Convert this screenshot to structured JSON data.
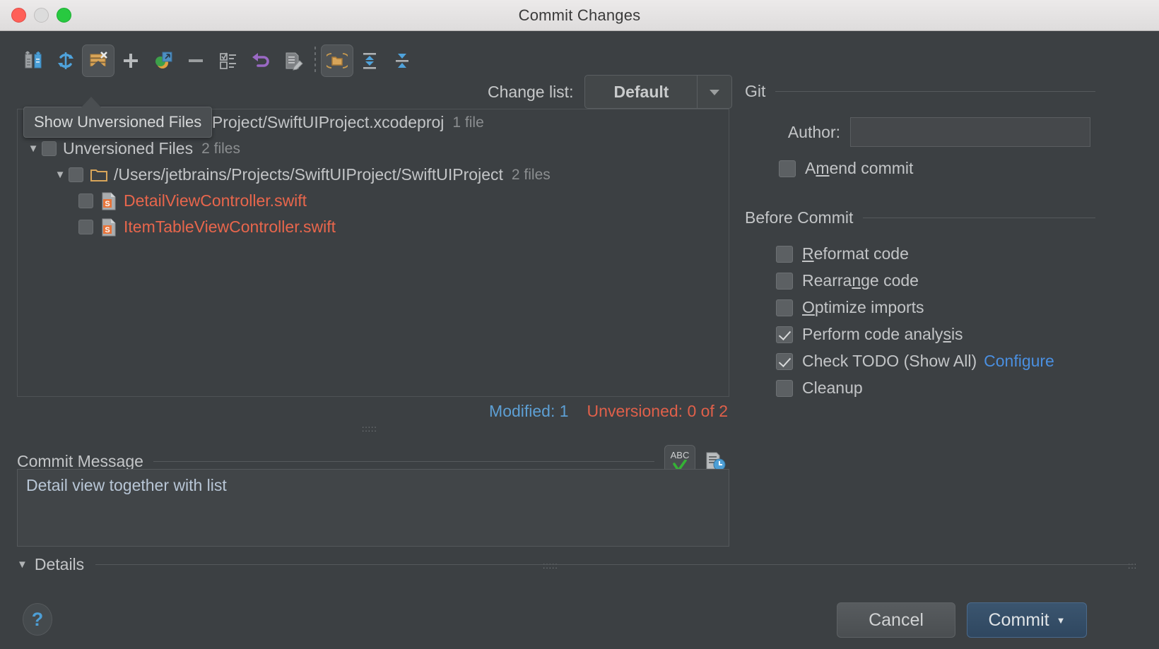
{
  "window": {
    "title": "Commit Changes",
    "traffic": [
      "close",
      "minimize",
      "maximize"
    ]
  },
  "toolbar": {
    "buttons": [
      {
        "name": "refresh-changes-icon",
        "tip": "Refresh changes"
      },
      {
        "name": "rollback-sync-icon",
        "tip": "Refresh"
      },
      {
        "name": "show-unversioned-files-icon",
        "tip": "Show Unversioned Files",
        "selected": true
      },
      {
        "name": "add-icon",
        "tip": "Add"
      },
      {
        "name": "move-to-another-changelist-icon",
        "tip": "Move to another changelist"
      },
      {
        "name": "delete-icon",
        "tip": "Delete"
      },
      {
        "name": "show-diff-list-icon",
        "tip": "Show diff list"
      },
      {
        "name": "revert-icon",
        "tip": "Revert"
      },
      {
        "name": "edit-source-icon",
        "tip": "Edit source"
      },
      {
        "name": "group-by-directory-icon",
        "tip": "Group by directory",
        "selected": true
      },
      {
        "name": "expand-all-icon",
        "tip": "Expand All"
      },
      {
        "name": "collapse-all-icon",
        "tip": "Collapse All"
      }
    ]
  },
  "tooltip": {
    "text": "Show Unversioned Files"
  },
  "changelist": {
    "label": "Change list:",
    "value": "Default",
    "arrow": "▼"
  },
  "tree": {
    "rows": [
      {
        "level": 1,
        "twisty": "",
        "label": "ains/Projects/SwiftUIProject/SwiftUIProject.xcodeproj",
        "count": "1 file",
        "icon": "",
        "color": "normal",
        "checkbox": false
      },
      {
        "level": 0,
        "twisty": "▼",
        "label": "Unversioned Files",
        "count": "2 files",
        "icon": "",
        "color": "normal",
        "checkbox": true
      },
      {
        "level": 1,
        "twisty": "▼",
        "label": "/Users/jetbrains/Projects/SwiftUIProject/SwiftUIProject",
        "count": "2 files",
        "icon": "folder-icon",
        "color": "normal",
        "checkbox": true
      },
      {
        "level": 2,
        "twisty": "",
        "label": "DetailViewController.swift",
        "count": "",
        "icon": "swift-file-icon",
        "color": "red",
        "checkbox": true
      },
      {
        "level": 2,
        "twisty": "",
        "label": "ItemTableViewController.swift",
        "count": "",
        "icon": "swift-file-icon",
        "color": "red",
        "checkbox": true
      }
    ]
  },
  "counts": {
    "modified": "Modified: 1",
    "unversioned": "Unversioned: 0 of 2",
    "modified_color": "#5d9fd4",
    "unversioned_color": "#e0604a"
  },
  "commit_message": {
    "title": "Commit Message",
    "value": "Detail view together with list",
    "spellcheck_icon_label": "ABC",
    "history_icon": "message-history-icon"
  },
  "details": {
    "twisty": "▼",
    "label": "Details"
  },
  "git": {
    "title": "Git",
    "author_label": "Author:",
    "author_value": "",
    "author_placeholder": "",
    "amend": {
      "label": "Amend commit",
      "underline": "m",
      "checked": false
    }
  },
  "before_commit": {
    "title": "Before Commit",
    "items": [
      {
        "label": "Reformat code",
        "underline": "R",
        "checked": false
      },
      {
        "label": "Rearrange code",
        "underline": "n",
        "checked": false
      },
      {
        "label": "Optimize imports",
        "underline": "O",
        "checked": false
      },
      {
        "label": "Perform code analysis",
        "underline": "s",
        "checked": true
      },
      {
        "label": "Check TODO (Show All)",
        "underline": "",
        "checked": true,
        "link": "Configure"
      },
      {
        "label": "Cleanup",
        "underline": "",
        "checked": false
      }
    ]
  },
  "footer": {
    "help_label": "?",
    "cancel_label": "Cancel",
    "commit_label": "Commit",
    "commit_arrow": "▼"
  },
  "colors": {
    "background": "#3c4043",
    "accent_blue": "#4a8fe0",
    "link_blue": "#4a8fe0",
    "unversioned_red": "#e8664c",
    "commit_button": "#35506a"
  }
}
